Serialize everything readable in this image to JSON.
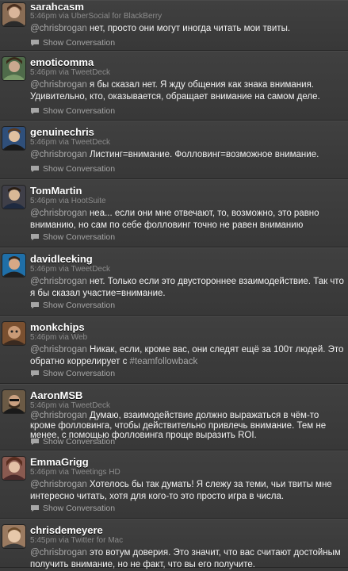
{
  "tweets": [
    {
      "username": "sarahcasm",
      "meta": "5:46pm via UberSocial for BlackBerry",
      "mention": "@chrisbrogan",
      "text": " нет, просто они могут иногда читать мои твиты.",
      "show_conversation": "Show Conversation",
      "avatar_color": "#8a6d55"
    },
    {
      "username": "emoticomma",
      "meta": "5:46pm via TweetDeck",
      "mention": "@chrisbrogan",
      "text": " я бы сказал нет. Я жду общения как знака внимания. Удивительно, кто, оказывается, обращает внимание на самом деле.",
      "show_conversation": "Show Conversation",
      "avatar_color": "#4f6b4a"
    },
    {
      "username": "genuinechris",
      "meta": "5:46pm via TweetDeck",
      "mention": "@chrisbrogan",
      "text": " Листинг=внимание. Фолловинг=возможное внимание.",
      "show_conversation": "Show Conversation",
      "avatar_color": "#2f4f7a"
    },
    {
      "username": "TomMartin",
      "meta": "5:46pm via HootSuite",
      "mention": "@chrisbrogan",
      "text": " неа... если они мне отвечают, то, возможно, это равно вниманию, но сам по себе фолловинг точно не равен вниманию",
      "show_conversation": "Show Conversation",
      "avatar_color": "#3f3f48"
    },
    {
      "username": "davidleeking",
      "meta": "5:46pm via TweetDeck",
      "mention": "@chrisbrogan",
      "text": " нет. Только если это двустороннее взаимодействие. Так что я бы сказал участие=внимание.",
      "show_conversation": "Show Conversation",
      "avatar_color": "#1f6fa8"
    },
    {
      "username": "monkchips",
      "meta": "5:46pm via Web",
      "mention": "@chrisbrogan",
      "text": " Никак, если, кроме вас, они следят ещё за 100т людей. Это обратно коррелирует с ",
      "hashtag": "#teamfollowback",
      "show_conversation": "Show Conversation",
      "avatar_color": "#7a5030"
    },
    {
      "username": "AaronMSB",
      "meta": "5:46pm via TweetDeck",
      "mention": "@chrisbrogan",
      "text": " Думаю, взаимодействие должно выражаться в чём-то кроме фолловинга, чтобы действительно привлечь внимание. Тем не менее, с помощью фолловинга проще выразить ROI.",
      "show_conversation": "Show Conversation",
      "avatar_color": "#6b5a45"
    },
    {
      "username": "EmmaGrigg",
      "meta": "5:46pm via Tweetings HD",
      "mention": "@chrisbrogan",
      "text": " Хотелось бы так думать! Я слежу за теми, чьи твиты мне интересно читать, хотя для кого-то это просто игра в числа.",
      "show_conversation": "Show Conversation",
      "avatar_color": "#8a5a50"
    },
    {
      "username": "chrisdemeyere",
      "meta": "5:45pm via Twitter for Mac",
      "mention": "@chrisbrogan",
      "text": " это вотум доверия. Это значит, что вас считают достойным получить внимание, но не факт, что вы его получите.",
      "show_conversation": "",
      "avatar_color": "#9a7a60"
    }
  ]
}
